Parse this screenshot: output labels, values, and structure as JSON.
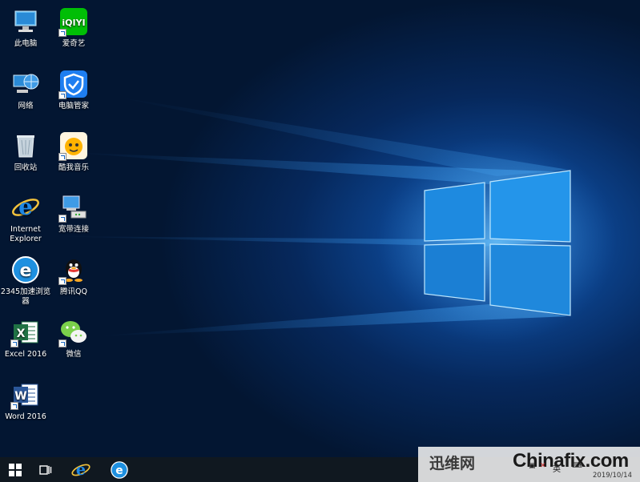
{
  "desktop": {
    "icons_left": [
      {
        "label": "此电脑",
        "icon": "this-pc-icon"
      },
      {
        "label": "网络",
        "icon": "network-icon"
      },
      {
        "label": "回收站",
        "icon": "recycle-bin-icon"
      },
      {
        "label": "Internet Explorer",
        "icon": "internet-explorer-icon"
      },
      {
        "label": "2345加速浏览器",
        "icon": "2345-browser-icon"
      },
      {
        "label": "Excel 2016",
        "icon": "excel-icon"
      },
      {
        "label": "Word 2016",
        "icon": "word-icon"
      }
    ],
    "icons_right": [
      {
        "label": "爱奇艺",
        "icon": "iqiyi-icon"
      },
      {
        "label": "电脑管家",
        "icon": "pc-manager-icon"
      },
      {
        "label": "酷我音乐",
        "icon": "kuwo-music-icon"
      },
      {
        "label": "宽带连接",
        "icon": "broadband-connection-icon"
      },
      {
        "label": "腾讯QQ",
        "icon": "qq-icon"
      },
      {
        "label": "微信",
        "icon": "wechat-icon"
      }
    ]
  },
  "taskbar": {
    "buttons": [
      "start-icon",
      "task-view-icon",
      "internet-explorer-icon",
      "2345-browser-icon"
    ],
    "tray": {
      "ime": "英",
      "date": "2019/10/14"
    }
  },
  "watermark": {
    "left_logo": "迅维网",
    "brand": "Chinafix.com"
  },
  "colors": {
    "taskbar": "#101820",
    "desktop_bg": "#06285c",
    "accent": "#1f6fc8"
  }
}
